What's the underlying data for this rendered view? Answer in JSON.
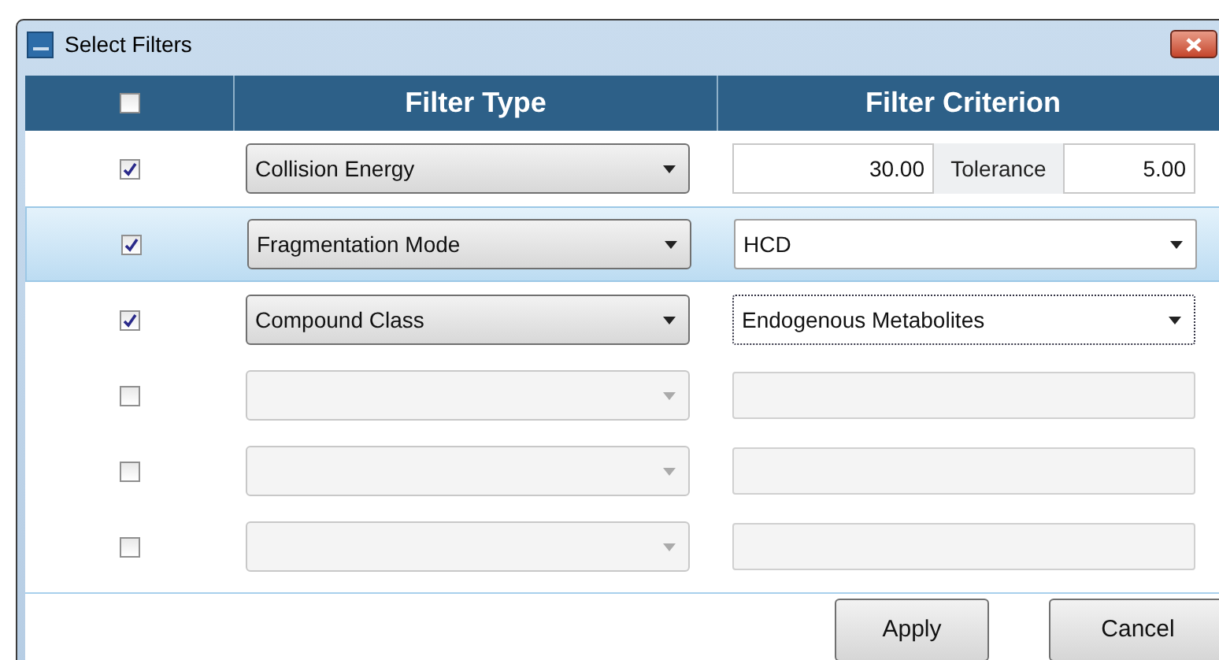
{
  "window": {
    "title": "Select Filters"
  },
  "header": {
    "select_all_checked": false,
    "columns": [
      "Filter Type",
      "Filter Criterion"
    ]
  },
  "rows": [
    {
      "checked": true,
      "selected": false,
      "filter_type": "Collision Energy",
      "criterion": {
        "kind": "tolerance",
        "value": "30.00",
        "label": "Tolerance",
        "tolerance": "5.00"
      }
    },
    {
      "checked": true,
      "selected": true,
      "filter_type": "Fragmentation Mode",
      "criterion": {
        "kind": "dropdown",
        "value": "HCD",
        "focused": false
      }
    },
    {
      "checked": true,
      "selected": false,
      "filter_type": "Compound Class",
      "criterion": {
        "kind": "dropdown",
        "value": "Endogenous Metabolites",
        "focused": true
      }
    },
    {
      "checked": false,
      "selected": false,
      "criterion": {
        "kind": "empty"
      }
    },
    {
      "checked": false,
      "selected": false,
      "criterion": {
        "kind": "empty"
      }
    },
    {
      "checked": false,
      "selected": false,
      "criterion": {
        "kind": "empty"
      }
    }
  ],
  "buttons": [
    "Apply",
    "Cancel"
  ]
}
